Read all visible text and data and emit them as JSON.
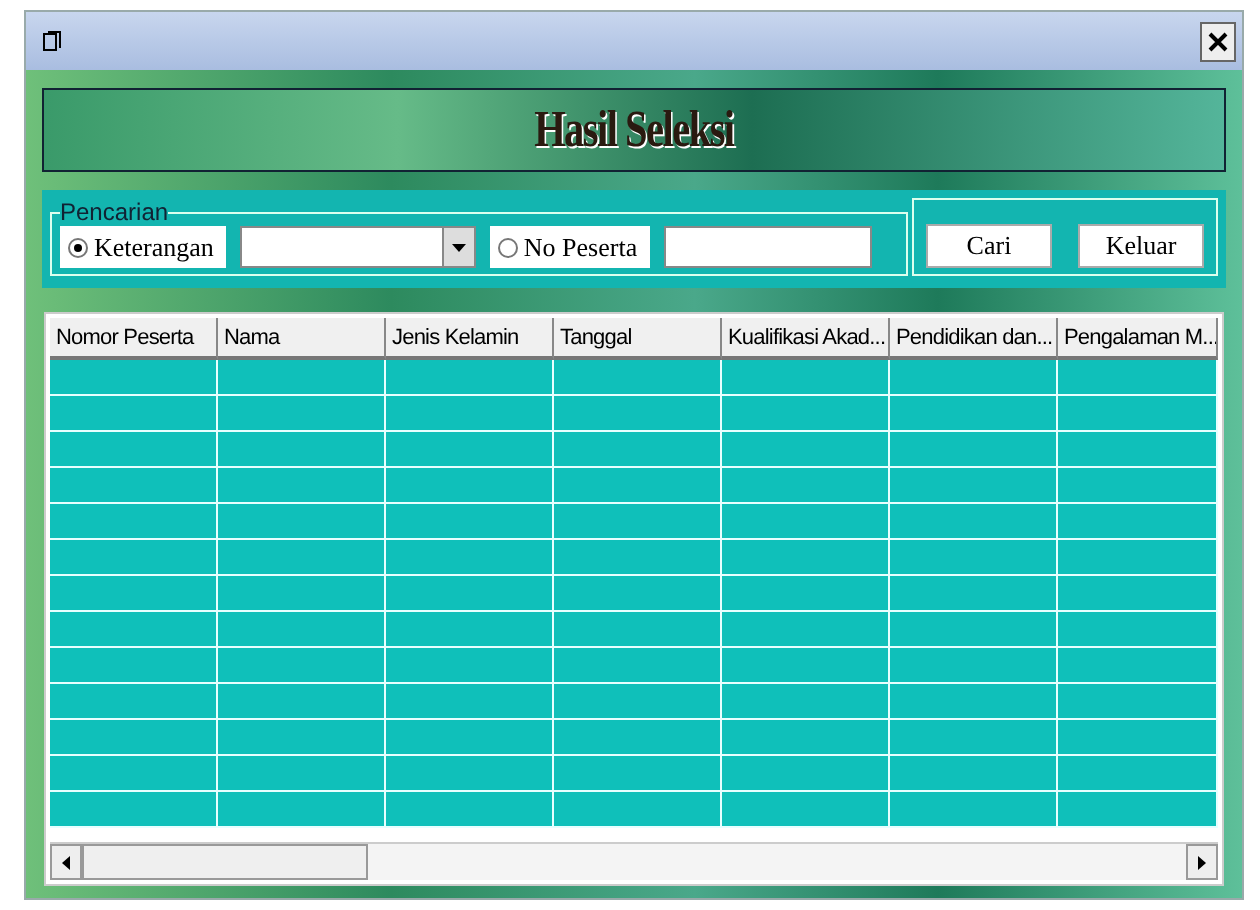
{
  "banner": {
    "title": "Hasil Seleksi"
  },
  "search_group": {
    "legend": "Pencarian",
    "options": [
      {
        "label": "Keterangan",
        "selected": true,
        "kind": "dropdown"
      },
      {
        "label": "No Peserta",
        "selected": false,
        "kind": "text"
      }
    ],
    "buttons": [
      "Cari",
      "Keluar"
    ]
  },
  "table": {
    "columns": [
      "Nomor Peserta",
      "Nama",
      "Jenis Kelamin",
      "Tanggal",
      "Kualifikasi Akad...",
      "Pendidikan dan...",
      "Pengalaman M..."
    ]
  }
}
